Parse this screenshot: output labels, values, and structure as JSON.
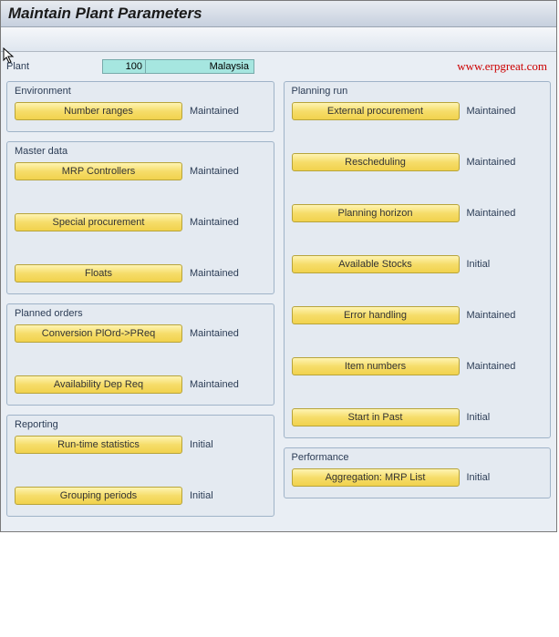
{
  "title": "Maintain Plant Parameters",
  "watermark": "www.erpgreat.com",
  "plant": {
    "label": "Plant",
    "code": "100",
    "name": "Malaysia"
  },
  "left_groups": [
    {
      "title": "Environment",
      "rows": [
        {
          "label": "Number ranges",
          "status": "Maintained",
          "tall": false
        }
      ]
    },
    {
      "title": "Master data",
      "rows": [
        {
          "label": "MRP Controllers",
          "status": "Maintained",
          "tall": false
        },
        {
          "label": "Special procurement",
          "status": "Maintained",
          "tall": true
        },
        {
          "label": "Floats",
          "status": "Maintained",
          "tall": true
        }
      ]
    },
    {
      "title": "Planned orders",
      "rows": [
        {
          "label": "Conversion PlOrd->PReq",
          "status": "Maintained",
          "tall": false
        },
        {
          "label": "Availability Dep Req",
          "status": "Maintained",
          "tall": true
        }
      ]
    },
    {
      "title": "Reporting",
      "rows": [
        {
          "label": "Run-time statistics",
          "status": "Initial",
          "tall": false
        },
        {
          "label": "Grouping periods",
          "status": "Initial",
          "tall": true
        }
      ]
    }
  ],
  "right_groups": [
    {
      "title": "Planning run",
      "rows": [
        {
          "label": "External procurement",
          "status": "Maintained",
          "tall": false
        },
        {
          "label": "Rescheduling",
          "status": "Maintained",
          "tall": true
        },
        {
          "label": "Planning horizon",
          "status": "Maintained",
          "tall": true
        },
        {
          "label": "Available Stocks",
          "status": "Initial",
          "tall": true
        },
        {
          "label": "Error handling",
          "status": "Maintained",
          "tall": true
        },
        {
          "label": "Item numbers",
          "status": "Maintained",
          "tall": true
        },
        {
          "label": "Start in Past",
          "status": "Initial",
          "tall": true
        }
      ]
    },
    {
      "title": "Performance",
      "rows": [
        {
          "label": "Aggregation: MRP List",
          "status": "Initial",
          "tall": false
        }
      ]
    }
  ]
}
